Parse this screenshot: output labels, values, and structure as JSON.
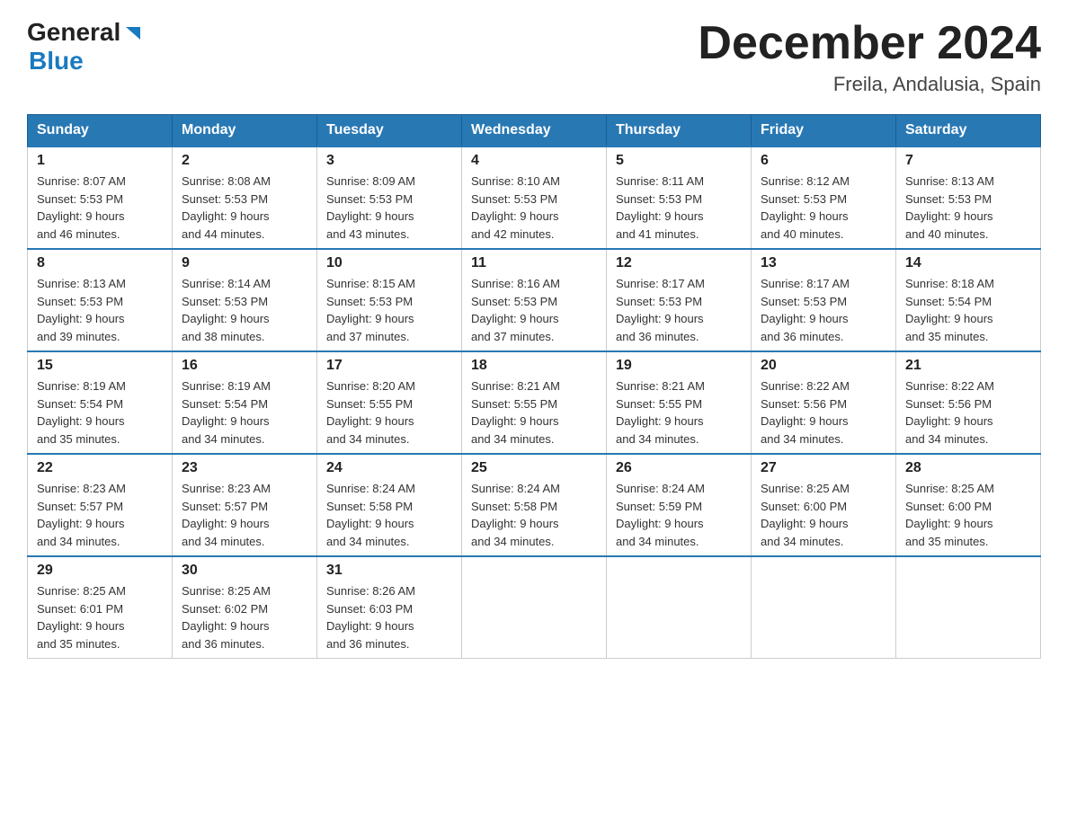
{
  "header": {
    "logo": {
      "general": "General",
      "blue": "Blue"
    },
    "title": "December 2024",
    "location": "Freila, Andalusia, Spain"
  },
  "days_of_week": [
    "Sunday",
    "Monday",
    "Tuesday",
    "Wednesday",
    "Thursday",
    "Friday",
    "Saturday"
  ],
  "weeks": [
    [
      {
        "day": "1",
        "sunrise": "8:07 AM",
        "sunset": "5:53 PM",
        "daylight": "9 hours and 46 minutes."
      },
      {
        "day": "2",
        "sunrise": "8:08 AM",
        "sunset": "5:53 PM",
        "daylight": "9 hours and 44 minutes."
      },
      {
        "day": "3",
        "sunrise": "8:09 AM",
        "sunset": "5:53 PM",
        "daylight": "9 hours and 43 minutes."
      },
      {
        "day": "4",
        "sunrise": "8:10 AM",
        "sunset": "5:53 PM",
        "daylight": "9 hours and 42 minutes."
      },
      {
        "day": "5",
        "sunrise": "8:11 AM",
        "sunset": "5:53 PM",
        "daylight": "9 hours and 41 minutes."
      },
      {
        "day": "6",
        "sunrise": "8:12 AM",
        "sunset": "5:53 PM",
        "daylight": "9 hours and 40 minutes."
      },
      {
        "day": "7",
        "sunrise": "8:13 AM",
        "sunset": "5:53 PM",
        "daylight": "9 hours and 40 minutes."
      }
    ],
    [
      {
        "day": "8",
        "sunrise": "8:13 AM",
        "sunset": "5:53 PM",
        "daylight": "9 hours and 39 minutes."
      },
      {
        "day": "9",
        "sunrise": "8:14 AM",
        "sunset": "5:53 PM",
        "daylight": "9 hours and 38 minutes."
      },
      {
        "day": "10",
        "sunrise": "8:15 AM",
        "sunset": "5:53 PM",
        "daylight": "9 hours and 37 minutes."
      },
      {
        "day": "11",
        "sunrise": "8:16 AM",
        "sunset": "5:53 PM",
        "daylight": "9 hours and 37 minutes."
      },
      {
        "day": "12",
        "sunrise": "8:17 AM",
        "sunset": "5:53 PM",
        "daylight": "9 hours and 36 minutes."
      },
      {
        "day": "13",
        "sunrise": "8:17 AM",
        "sunset": "5:53 PM",
        "daylight": "9 hours and 36 minutes."
      },
      {
        "day": "14",
        "sunrise": "8:18 AM",
        "sunset": "5:54 PM",
        "daylight": "9 hours and 35 minutes."
      }
    ],
    [
      {
        "day": "15",
        "sunrise": "8:19 AM",
        "sunset": "5:54 PM",
        "daylight": "9 hours and 35 minutes."
      },
      {
        "day": "16",
        "sunrise": "8:19 AM",
        "sunset": "5:54 PM",
        "daylight": "9 hours and 34 minutes."
      },
      {
        "day": "17",
        "sunrise": "8:20 AM",
        "sunset": "5:55 PM",
        "daylight": "9 hours and 34 minutes."
      },
      {
        "day": "18",
        "sunrise": "8:21 AM",
        "sunset": "5:55 PM",
        "daylight": "9 hours and 34 minutes."
      },
      {
        "day": "19",
        "sunrise": "8:21 AM",
        "sunset": "5:55 PM",
        "daylight": "9 hours and 34 minutes."
      },
      {
        "day": "20",
        "sunrise": "8:22 AM",
        "sunset": "5:56 PM",
        "daylight": "9 hours and 34 minutes."
      },
      {
        "day": "21",
        "sunrise": "8:22 AM",
        "sunset": "5:56 PM",
        "daylight": "9 hours and 34 minutes."
      }
    ],
    [
      {
        "day": "22",
        "sunrise": "8:23 AM",
        "sunset": "5:57 PM",
        "daylight": "9 hours and 34 minutes."
      },
      {
        "day": "23",
        "sunrise": "8:23 AM",
        "sunset": "5:57 PM",
        "daylight": "9 hours and 34 minutes."
      },
      {
        "day": "24",
        "sunrise": "8:24 AM",
        "sunset": "5:58 PM",
        "daylight": "9 hours and 34 minutes."
      },
      {
        "day": "25",
        "sunrise": "8:24 AM",
        "sunset": "5:58 PM",
        "daylight": "9 hours and 34 minutes."
      },
      {
        "day": "26",
        "sunrise": "8:24 AM",
        "sunset": "5:59 PM",
        "daylight": "9 hours and 34 minutes."
      },
      {
        "day": "27",
        "sunrise": "8:25 AM",
        "sunset": "6:00 PM",
        "daylight": "9 hours and 34 minutes."
      },
      {
        "day": "28",
        "sunrise": "8:25 AM",
        "sunset": "6:00 PM",
        "daylight": "9 hours and 35 minutes."
      }
    ],
    [
      {
        "day": "29",
        "sunrise": "8:25 AM",
        "sunset": "6:01 PM",
        "daylight": "9 hours and 35 minutes."
      },
      {
        "day": "30",
        "sunrise": "8:25 AM",
        "sunset": "6:02 PM",
        "daylight": "9 hours and 36 minutes."
      },
      {
        "day": "31",
        "sunrise": "8:26 AM",
        "sunset": "6:03 PM",
        "daylight": "9 hours and 36 minutes."
      },
      null,
      null,
      null,
      null
    ]
  ],
  "labels": {
    "sunrise": "Sunrise:",
    "sunset": "Sunset:",
    "daylight": "Daylight:"
  }
}
